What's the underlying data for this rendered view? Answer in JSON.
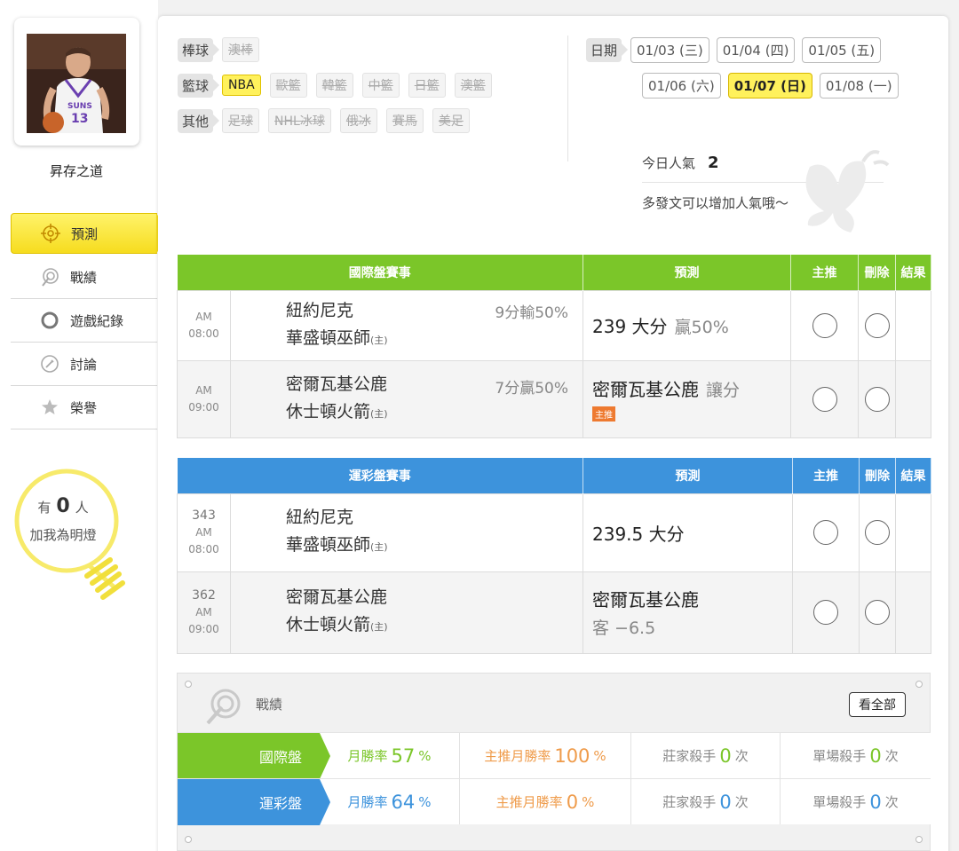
{
  "sidebar": {
    "username": "昇存之道",
    "nav": [
      {
        "label": "預測",
        "icon": "target-icon",
        "active": true
      },
      {
        "label": "戰績",
        "icon": "trophy-target-icon"
      },
      {
        "label": "遊戲紀錄",
        "icon": "circle-icon"
      },
      {
        "label": "討論",
        "icon": "discussion-icon"
      },
      {
        "label": "榮譽",
        "icon": "medal-icon"
      }
    ],
    "bulb": {
      "prefix": "有",
      "count": "0",
      "suffix": "人",
      "caption": "加我為明燈"
    }
  },
  "filters": {
    "baseball": {
      "label": "棒球",
      "items": [
        "澳棒"
      ]
    },
    "basketball": {
      "label": "籃球",
      "items": [
        "NBA",
        "歐籃",
        "韓籃",
        "中籃",
        "日籃",
        "澳籃"
      ],
      "active": "NBA"
    },
    "other": {
      "label": "其他",
      "items": [
        "足球",
        "NHL冰球",
        "俄冰",
        "賽馬",
        "美足"
      ]
    }
  },
  "dates": {
    "label": "日期",
    "row1": [
      "01/03 (三)",
      "01/04 (四)",
      "01/05 (五)"
    ],
    "row2": [
      "01/06 (六)",
      "01/07 (日)",
      "01/08 (一)"
    ],
    "active": "01/07 (日)"
  },
  "popularity": {
    "label": "今日人氣",
    "value": "2",
    "tip": "多發文可以增加人氣哦～"
  },
  "intl_table": {
    "headers": [
      "國際盤賽事",
      "預測",
      "主推",
      "刪除",
      "結果"
    ],
    "rows": [
      {
        "ampm": "AM",
        "time": "08:00",
        "away": "紐約尼克",
        "home": "華盛頓巫師",
        "home_mark": "(主)",
        "handicap": "9分輸50%",
        "pred_main": "239 大分",
        "pred_sub": "贏50%",
        "tag": ""
      },
      {
        "ampm": "AM",
        "time": "09:00",
        "away": "密爾瓦基公鹿",
        "home": "休士頓火箭",
        "home_mark": "(主)",
        "handicap": "7分贏50%",
        "pred_main": "密爾瓦基公鹿",
        "pred_sub": "讓分",
        "tag": "主推"
      }
    ]
  },
  "lottery_table": {
    "headers": [
      "運彩盤賽事",
      "預測",
      "主推",
      "刪除",
      "結果"
    ],
    "rows": [
      {
        "num": "343",
        "ampm": "AM",
        "time": "08:00",
        "away": "紐約尼克",
        "home": "華盛頓巫師",
        "home_mark": "(主)",
        "pred_main": "239.5 大分",
        "pred_line2": ""
      },
      {
        "num": "362",
        "ampm": "AM",
        "time": "09:00",
        "away": "密爾瓦基公鹿",
        "home": "休士頓火箭",
        "home_mark": "(主)",
        "pred_main": "密爾瓦基公鹿",
        "pred_line2": "客 −6.5"
      }
    ]
  },
  "record": {
    "title": "戰績",
    "view_all": "看全部",
    "rows": [
      {
        "label": "國際盤",
        "color": "#7bc629",
        "month_rate_label": "月勝率",
        "month_rate": "57",
        "main_rate_label": "主推月勝率",
        "main_rate": "100",
        "pct": "%",
        "banker_label": "莊家殺手",
        "banker": "0",
        "single_label": "單場殺手",
        "single": "0",
        "times": "次"
      },
      {
        "label": "運彩盤",
        "color": "#3d93dc",
        "month_rate_label": "月勝率",
        "month_rate": "64",
        "main_rate_label": "主推月勝率",
        "main_rate": "0",
        "pct": "%",
        "banker_label": "莊家殺手",
        "banker": "0",
        "single_label": "單場殺手",
        "single": "0",
        "times": "次"
      }
    ]
  }
}
